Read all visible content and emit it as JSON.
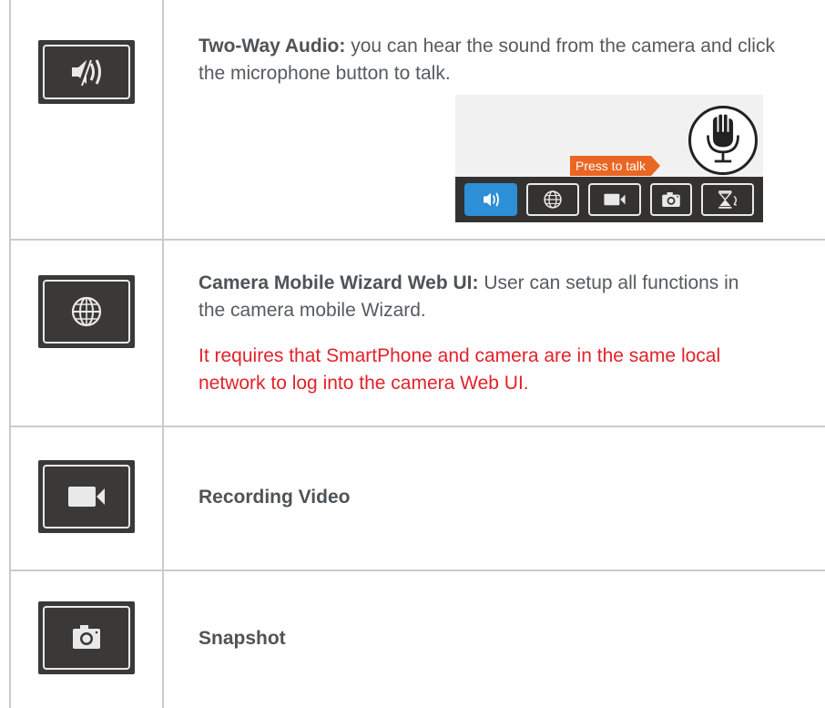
{
  "rows": [
    {
      "icon": "speaker-mute-icon",
      "title": "Two-Way Audio:",
      "text": "you can hear the sound from the camera and click the microphone button to talk.",
      "screenshot": {
        "bubble_label": "Press to talk",
        "mic_icon": "microphone-icon",
        "toolbar": [
          "speaker-icon",
          "globe-icon",
          "video-camera-icon",
          "camera-icon",
          "flip-icon"
        ],
        "active_color": "#2d8fd5"
      }
    },
    {
      "icon": "globe-icon",
      "title": "Camera Mobile Wizard Web UI:",
      "text": "User can setup all functions in the camera mobile Wizard.",
      "note": "It requires that SmartPhone and camera are in the same local network to log into the camera Web UI."
    },
    {
      "icon": "video-camera-icon",
      "title": "Recording Video"
    },
    {
      "icon": "camera-icon",
      "title": "Snapshot"
    }
  ],
  "colors": {
    "note": "#e32129",
    "icon_bg": "#3a3938",
    "bubble": "#e96623"
  }
}
